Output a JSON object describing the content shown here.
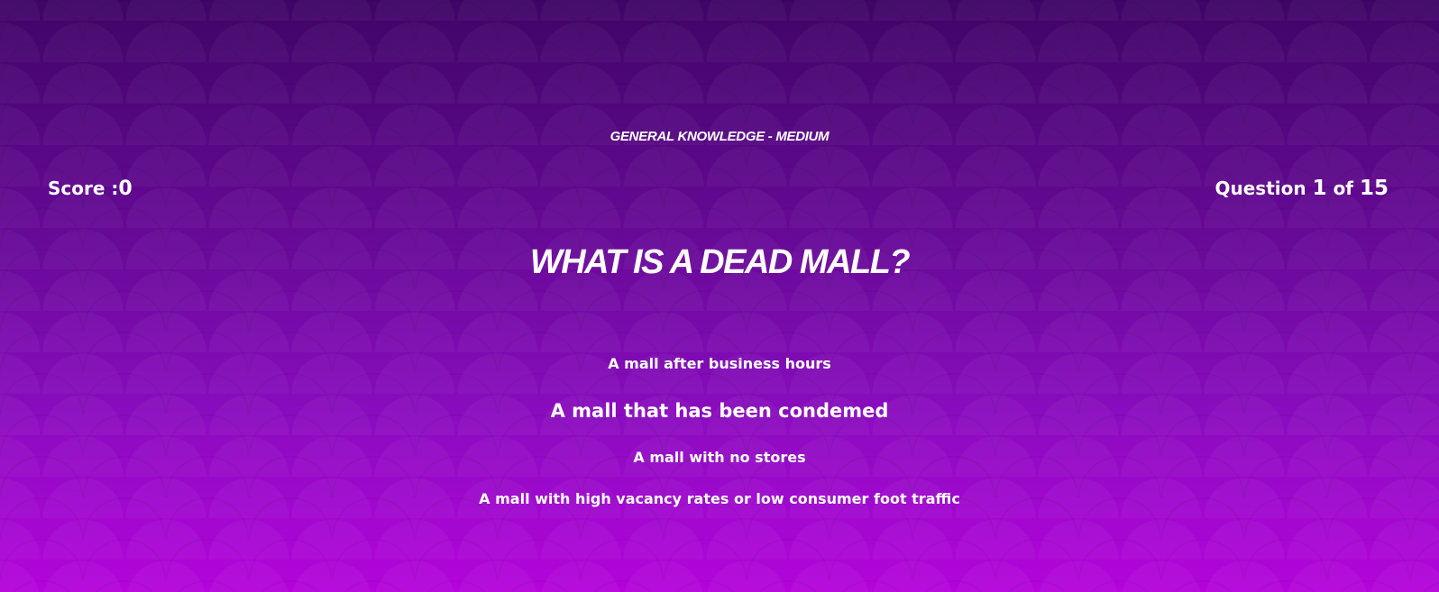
{
  "quiz": {
    "category": "General Knowledge - Medium",
    "score_label": "Score :",
    "score_value": "0",
    "progress_label": "Question",
    "current_question": "1",
    "of_label": "of",
    "total_questions": "15",
    "question": "What is a dead mall?",
    "answers": [
      "A mall after business hours",
      "A mall that has been condemed",
      "A mall with no stores",
      "A mall with high vacancy rates or low consumer foot traffic"
    ]
  },
  "colors": {
    "gradient_top": "#3f0566",
    "gradient_bottom": "#b404db",
    "text": "#ffffff"
  }
}
